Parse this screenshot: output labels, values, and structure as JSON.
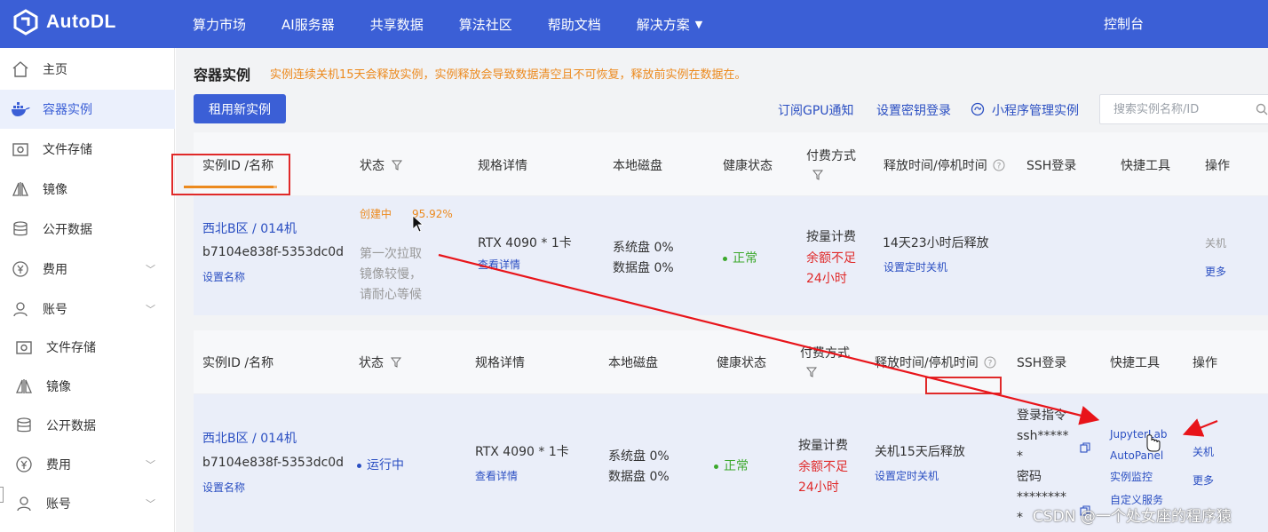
{
  "topbar": {
    "brand": "AutoDL",
    "nav": [
      "算力市场",
      "AI服务器",
      "共享数据",
      "算法社区",
      "帮助文档",
      "解决方案"
    ],
    "console": "控制台"
  },
  "sidebar": {
    "items": [
      {
        "label": "主页",
        "icon": "home-icon"
      },
      {
        "label": "容器实例",
        "icon": "docker-icon",
        "active": true
      },
      {
        "label": "文件存储",
        "icon": "storage-icon"
      },
      {
        "label": "镜像",
        "icon": "mirror-icon"
      },
      {
        "label": "公开数据",
        "icon": "database-icon"
      },
      {
        "label": "费用",
        "icon": "yen-icon",
        "expandable": true
      },
      {
        "label": "账号",
        "icon": "user-icon",
        "expandable": true
      }
    ],
    "items2": [
      {
        "label": "文件存储",
        "icon": "storage-icon"
      },
      {
        "label": "镜像",
        "icon": "mirror-icon"
      },
      {
        "label": "公开数据",
        "icon": "database-icon"
      },
      {
        "label": "费用",
        "icon": "yen-icon",
        "expandable": true
      },
      {
        "label": "账号",
        "icon": "user-icon",
        "expandable": true
      }
    ]
  },
  "page": {
    "title": "容器实例",
    "warning": "实例连续关机15天会释放实例，实例释放会导致数据清空且不可恢复，释放前实例在数据在。",
    "rent_button": "租用新实例",
    "links": [
      "订阅GPU通知",
      "设置密钥登录",
      "小程序管理实例"
    ],
    "search_placeholder": "搜索实例名称/ID"
  },
  "table": {
    "headers": {
      "id": "实例ID /名称",
      "status": "状态",
      "spec": "规格详情",
      "disk": "本地磁盘",
      "health": "健康状态",
      "billing": "付费方式",
      "release": "释放时间/停机时间",
      "ssh": "SSH登录",
      "tools": "快捷工具",
      "ops": "操作"
    }
  },
  "row1": {
    "region": "西北B区 / 014机",
    "instance_id": "b7104e838f-5353dc0d",
    "set_name": "设置名称",
    "status_label": "创建中",
    "progress_text": "95.92%",
    "progress": 0.9592,
    "status_note": [
      "第一次拉取",
      "镜像较慢，",
      "请耐心等候"
    ],
    "gpu": "RTX 4090 * 1卡",
    "details": "查看详情",
    "disk_sys": "系统盘 0%",
    "disk_data": "数据盘 0%",
    "health": "正常",
    "billing": "按量计费",
    "balance_warn": [
      "余额不足",
      "24小时"
    ],
    "release": "14天23小时后释放",
    "schedule": "设置定时关机",
    "op_shutdown": "关机",
    "op_more": "更多"
  },
  "row2": {
    "region": "西北B区 / 014机",
    "instance_id": "b7104e838f-5353dc0d",
    "set_name": "设置名称",
    "status_label": "运行中",
    "gpu": "RTX 4090 * 1卡",
    "details": "查看详情",
    "disk_sys": "系统盘 0%",
    "disk_data": "数据盘 0%",
    "health": "正常",
    "billing": "按量计费",
    "balance_warn": [
      "余额不足",
      "24小时"
    ],
    "release": "关机15天后释放",
    "schedule": "设置定时关机",
    "ssh_cmd_label": "登录指令",
    "ssh_cmd": [
      "ssh*****",
      "*"
    ],
    "ssh_pwd_label": "密码",
    "ssh_pwd": [
      "********",
      "*"
    ],
    "tools": [
      "JupyterLab",
      "AutoPanel",
      "实例监控",
      "自定义服务"
    ],
    "op_shutdown": "关机",
    "op_more": "更多"
  },
  "watermark": "CSDN @一个处女座的程序猿",
  "colors": {
    "brand": "#3b5fd6",
    "link": "#2b4fc2",
    "warning": "#ec8a1e",
    "danger": "#e02929",
    "ok": "#3ca82c"
  }
}
